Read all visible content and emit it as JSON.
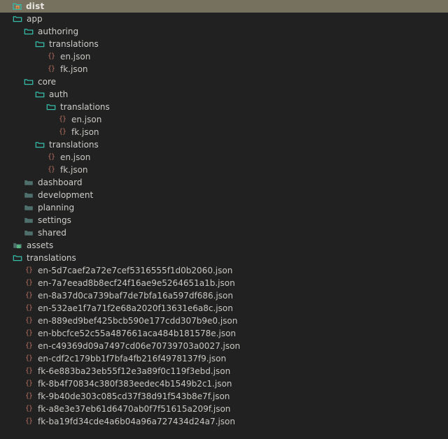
{
  "colors": {
    "header_background": "#76705e",
    "background": "#212121",
    "text": "#cccccc",
    "folder_open_stroke": "#35bdaa",
    "folder_closed_fill": "#4e6f6b",
    "json_brace": "#b5705f",
    "badge_green": "#3e8d5a",
    "root_icon_folder": "#35bdaa",
    "root_icon_badge": "#d08b4e"
  },
  "root": {
    "label": "dist",
    "icon": "folder-dist-icon"
  },
  "tree": [
    {
      "label": "app",
      "depth": 1,
      "type": "folder-open",
      "icon": "folder-open-icon"
    },
    {
      "label": "authoring",
      "depth": 2,
      "type": "folder-open",
      "icon": "folder-open-icon"
    },
    {
      "label": "translations",
      "depth": 3,
      "type": "folder-open",
      "icon": "folder-open-icon"
    },
    {
      "label": "en.json",
      "depth": 4,
      "type": "file-json",
      "icon": "json-braces-icon"
    },
    {
      "label": "fk.json",
      "depth": 4,
      "type": "file-json",
      "icon": "json-braces-icon"
    },
    {
      "label": "core",
      "depth": 2,
      "type": "folder-open",
      "icon": "folder-open-icon"
    },
    {
      "label": "auth",
      "depth": 3,
      "type": "folder-open",
      "icon": "folder-open-icon"
    },
    {
      "label": "translations",
      "depth": 4,
      "type": "folder-open",
      "icon": "folder-open-icon"
    },
    {
      "label": "en.json",
      "depth": 5,
      "type": "file-json",
      "icon": "json-braces-icon"
    },
    {
      "label": "fk.json",
      "depth": 5,
      "type": "file-json",
      "icon": "json-braces-icon"
    },
    {
      "label": "translations",
      "depth": 3,
      "type": "folder-open",
      "icon": "folder-open-icon"
    },
    {
      "label": "en.json",
      "depth": 4,
      "type": "file-json",
      "icon": "json-braces-icon"
    },
    {
      "label": "fk.json",
      "depth": 4,
      "type": "file-json",
      "icon": "json-braces-icon"
    },
    {
      "label": "dashboard",
      "depth": 2,
      "type": "folder-closed",
      "icon": "folder-closed-icon"
    },
    {
      "label": "development",
      "depth": 2,
      "type": "folder-closed",
      "icon": "folder-closed-icon"
    },
    {
      "label": "planning",
      "depth": 2,
      "type": "folder-closed",
      "icon": "folder-closed-icon"
    },
    {
      "label": "settings",
      "depth": 2,
      "type": "folder-closed",
      "icon": "folder-closed-icon"
    },
    {
      "label": "shared",
      "depth": 2,
      "type": "folder-closed",
      "icon": "folder-closed-icon"
    },
    {
      "label": "assets",
      "depth": 1,
      "type": "folder-assets",
      "icon": "folder-assets-icon"
    },
    {
      "label": "translations",
      "depth": 1,
      "type": "folder-open",
      "icon": "folder-open-icon"
    },
    {
      "label": "en-5d7caef2a72e7cef5316555f1d0b2060.json",
      "depth": 2,
      "type": "file-json",
      "icon": "json-braces-icon"
    },
    {
      "label": "en-7a7eead8b8ecf24f16ae9e5264651a1b.json",
      "depth": 2,
      "type": "file-json",
      "icon": "json-braces-icon"
    },
    {
      "label": "en-8a37d0ca739baf7de7bfa16a597df686.json",
      "depth": 2,
      "type": "file-json",
      "icon": "json-braces-icon"
    },
    {
      "label": "en-532ae1f7a71f2e68a2020f13631e6a8c.json",
      "depth": 2,
      "type": "file-json",
      "icon": "json-braces-icon"
    },
    {
      "label": "en-889ed9bef425bcb590e177cdd307b9e0.json",
      "depth": 2,
      "type": "file-json",
      "icon": "json-braces-icon"
    },
    {
      "label": "en-bbcfce52c55a487661aca484b181578e.json",
      "depth": 2,
      "type": "file-json",
      "icon": "json-braces-icon"
    },
    {
      "label": "en-c49369d09a7497cd06e70739703a0027.json",
      "depth": 2,
      "type": "file-json",
      "icon": "json-braces-icon"
    },
    {
      "label": "en-cdf2c179bb1f7bfa4fb216f4978137f9.json",
      "depth": 2,
      "type": "file-json",
      "icon": "json-braces-icon"
    },
    {
      "label": "fk-6e883ba23eb55f12e3a89f0c119f3ebd.json",
      "depth": 2,
      "type": "file-json",
      "icon": "json-braces-icon"
    },
    {
      "label": "fk-8b4f70834c380f383eedec4b1549b2c1.json",
      "depth": 2,
      "type": "file-json",
      "icon": "json-braces-icon"
    },
    {
      "label": "fk-9b40de303c085cd37f38d91f543b8e7f.json",
      "depth": 2,
      "type": "file-json",
      "icon": "json-braces-icon"
    },
    {
      "label": "fk-a8e3e37eb61d6470ab0f7f51615a209f.json",
      "depth": 2,
      "type": "file-json",
      "icon": "json-braces-icon"
    },
    {
      "label": "fk-ba19fd34cde4a6b04a96a727434d24a7.json",
      "depth": 2,
      "type": "file-json",
      "icon": "json-braces-icon"
    }
  ]
}
